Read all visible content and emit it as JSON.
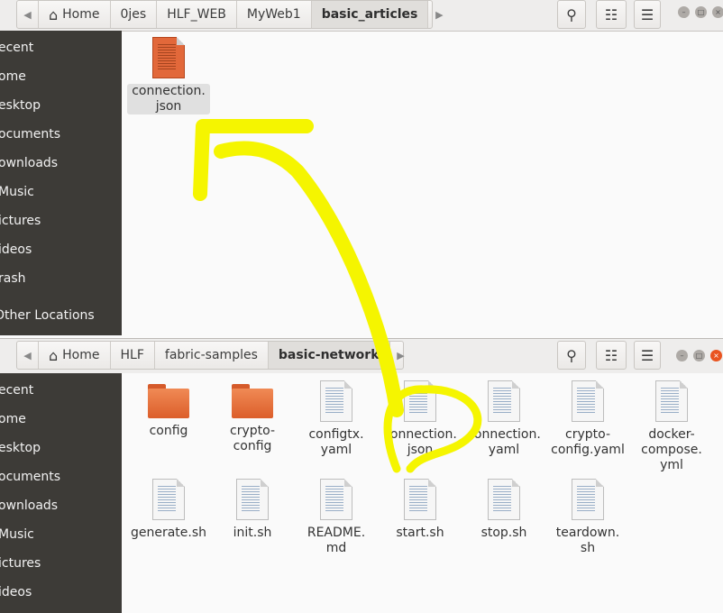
{
  "top_window": {
    "breadcrumbs": [
      "Home",
      "0jes",
      "HLF_WEB",
      "MyWeb1",
      "basic_articles"
    ],
    "active_crumb": "basic_articles",
    "sidebar": [
      "ecent",
      "ome",
      "esktop",
      "ocuments",
      "ownloads",
      "Music",
      "ictures",
      "ideos",
      "rash",
      "Other Locations"
    ],
    "files": [
      {
        "name": "connection.\njson",
        "icon": "orange-document-icon",
        "selected": true
      }
    ]
  },
  "bottom_window": {
    "breadcrumbs": [
      "Home",
      "HLF",
      "fabric-samples",
      "basic-network"
    ],
    "active_crumb": "basic-network",
    "sidebar": [
      "ecent",
      "ome",
      "esktop",
      "ocuments",
      "ownloads",
      "Music",
      "ictures",
      "ideos"
    ],
    "files": [
      {
        "name": "config",
        "icon": "folder-icon"
      },
      {
        "name": "crypto-\nconfig",
        "icon": "folder-icon"
      },
      {
        "name": "configtx.\nyaml",
        "icon": "document-icon"
      },
      {
        "name": "connection.\njson",
        "icon": "document-icon"
      },
      {
        "name": "connection.\nyaml",
        "icon": "document-icon"
      },
      {
        "name": "crypto-\nconfig.yaml",
        "icon": "document-icon"
      },
      {
        "name": "docker-\ncompose.\nyml",
        "icon": "document-icon"
      },
      {
        "name": "generate.sh",
        "icon": "script-icon"
      },
      {
        "name": "init.sh",
        "icon": "script-icon"
      },
      {
        "name": "README.\nmd",
        "icon": "document-icon"
      },
      {
        "name": "start.sh",
        "icon": "script-icon"
      },
      {
        "name": "stop.sh",
        "icon": "script-icon"
      },
      {
        "name": "teardown.\nsh",
        "icon": "script-icon"
      }
    ]
  },
  "annotation": {
    "color": "#f5f500",
    "meaning": "yellow arrow from bottom connection.json to top connection.json"
  },
  "colors": {
    "sidebar": "#3d3b37",
    "folder": "#e86f3b",
    "accent_orange": "#e2683a"
  }
}
